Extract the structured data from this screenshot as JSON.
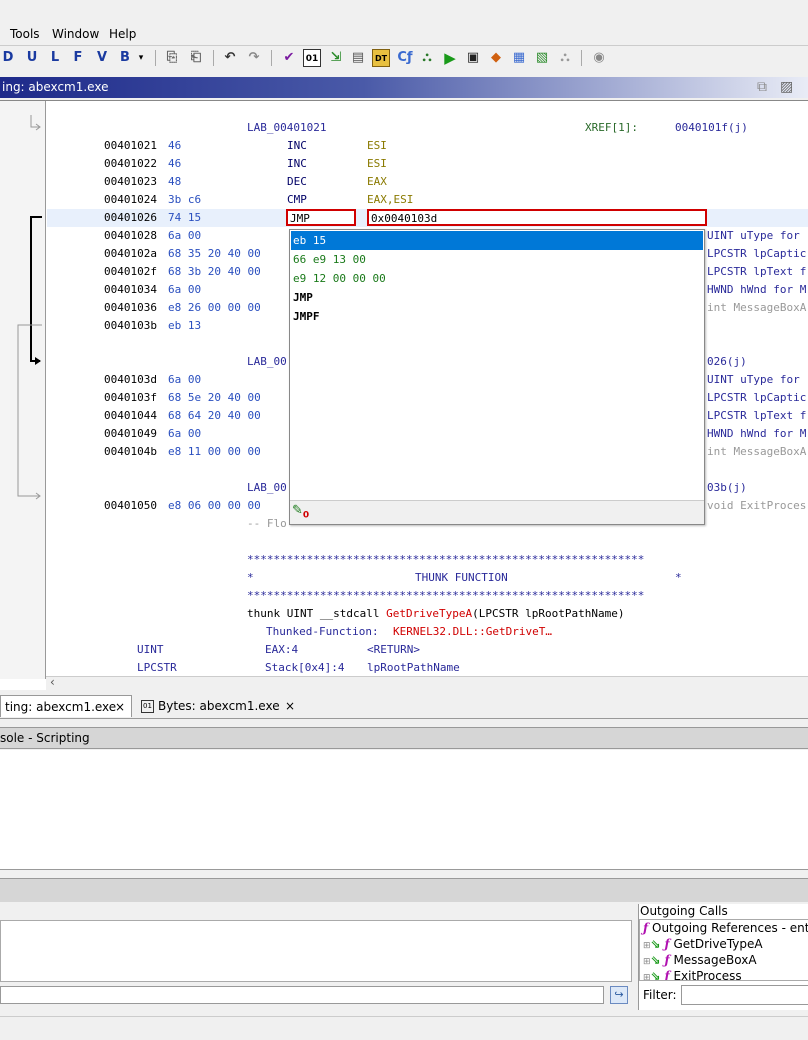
{
  "menu": [
    "Tools",
    "Window",
    "Help"
  ],
  "toolbar": {
    "letters": [
      "D",
      "U",
      "L",
      "F",
      "V",
      "B"
    ]
  },
  "window_title": "ing: abexcm1.exe",
  "listing": {
    "label1": "LAB_00401021",
    "xref1_label": "XREF[1]:",
    "xref1_value": "0040101f(j)",
    "rows1": [
      {
        "addr": "00401021",
        "bytes": "46",
        "mnem": "INC",
        "opnd": "ESI"
      },
      {
        "addr": "00401022",
        "bytes": "46",
        "mnem": "INC",
        "opnd": "ESI"
      },
      {
        "addr": "00401023",
        "bytes": "48",
        "mnem": "DEC",
        "opnd": "EAX"
      },
      {
        "addr": "00401024",
        "bytes": "3b c6",
        "mnem": "CMP",
        "opnd": "EAX,ESI"
      }
    ],
    "edit_row": {
      "addr": "00401026",
      "bytes": "74 15",
      "mnem": "JMP",
      "opnd": "0x0040103d"
    },
    "rows2": [
      {
        "addr": "00401028",
        "bytes": "6a 00",
        "cmt": "UINT uType for"
      },
      {
        "addr": "0040102a",
        "bytes": "68 35 20 40 00",
        "cmt": "LPCSTR lpCaptic"
      },
      {
        "addr": "0040102f",
        "bytes": "68 3b 20 40 00",
        "cmt": "LPCSTR lpText f"
      },
      {
        "addr": "00401034",
        "bytes": "6a 00",
        "cmt": "HWND hWnd for M"
      },
      {
        "addr": "00401036",
        "bytes": "e8 26 00 00 00",
        "cmt": "int MessageBoxA"
      },
      {
        "addr": "0040103b",
        "bytes": "eb 13",
        "cmt": ""
      }
    ],
    "label2": "LAB_00",
    "xref2_value": "026(j)",
    "rows3": [
      {
        "addr": "0040103d",
        "bytes": "6a 00",
        "cmt": "UINT uType for"
      },
      {
        "addr": "0040103f",
        "bytes": "68 5e 20 40 00",
        "cmt": "LPCSTR lpCaptic"
      },
      {
        "addr": "00401044",
        "bytes": "68 64 20 40 00",
        "cmt": "LPCSTR lpText f"
      },
      {
        "addr": "00401049",
        "bytes": "6a 00",
        "cmt": "HWND hWnd for M"
      },
      {
        "addr": "0040104b",
        "bytes": "e8 11 00 00 00",
        "cmt": "int MessageBoxA"
      }
    ],
    "label3": "LAB_00",
    "xref3_value": "03b(j)",
    "row4": {
      "addr": "00401050",
      "bytes": "e8 06 00 00 00",
      "cmt": "void ExitProces"
    },
    "flow_partial": "-- Flo",
    "stars": "************************************************************",
    "thunk_title": "THUNK FUNCTION",
    "thunk_sig_pre": "thunk UINT __stdcall ",
    "thunk_sig_fn": "GetDriveTypeA",
    "thunk_sig_post": "(LPCSTR lpRootPathName)",
    "thunked_label": "Thunked-Function:",
    "thunked_value": "KERNEL32.DLL::GetDriveT…",
    "param_rows": [
      {
        "type": "UINT",
        "loc": "EAX:4",
        "name": "<RETURN>"
      },
      {
        "type": "LPCSTR",
        "loc": "Stack[0x4]:4",
        "name": "lpRootPathName"
      }
    ]
  },
  "popup": {
    "items": [
      "eb 15",
      "66 e9 13 00",
      "e9 12 00 00 00",
      "JMP",
      "JMPF"
    ],
    "selected_index": 0
  },
  "tabs": [
    {
      "label": "ting: abexcm1.exe",
      "close": "×"
    },
    {
      "label": "Bytes: abexcm1.exe",
      "close": "×"
    }
  ],
  "console_title": "sole - Scripting",
  "outgoing": {
    "header": "Outgoing Calls",
    "root": "Outgoing References - ent",
    "items": [
      "GetDriveTypeA",
      "MessageBoxA",
      "ExitProcess"
    ],
    "filter_label": "Filter:"
  },
  "colors": {
    "selection": "#0078d7",
    "edit_border": "#d00000",
    "title_gradient": "#1e2a8a"
  }
}
